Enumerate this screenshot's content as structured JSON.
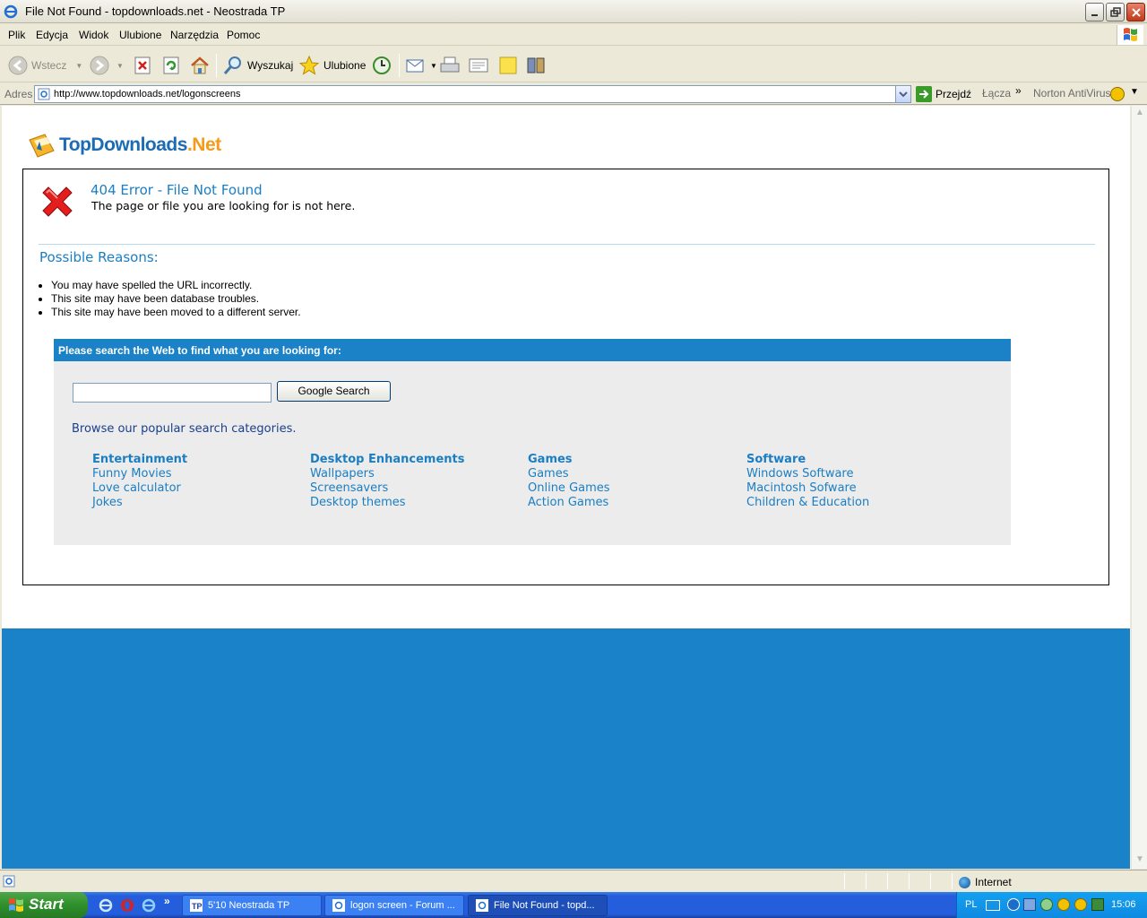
{
  "window": {
    "title": "File Not Found - topdownloads.net - Neostrada TP"
  },
  "menu": [
    "Plik",
    "Edycja",
    "Widok",
    "Ulubione",
    "Narzędzia",
    "Pomoc"
  ],
  "toolbar": {
    "back_label": "Wstecz",
    "search_label": "Wyszukaj",
    "favorites_label": "Ulubione"
  },
  "address": {
    "label": "Adres",
    "url": "http://www.topdownloads.net/logonscreens",
    "go_label": "Przejdź",
    "links_label": "Łącza",
    "links_chevron": "»",
    "norton_label": "Norton AntiVirus"
  },
  "page": {
    "logo_main": "TopDownloads",
    "logo_suffix": ".Net",
    "error_title": "404 Error - File Not Found",
    "error_subtitle": "The page or file you are looking for is not here.",
    "reasons_title": "Possible Reasons:",
    "reasons": [
      "You may have spelled the URL incorrectly.",
      "This site may have been database troubles.",
      "This site may have been moved to a different server."
    ],
    "search_heading": "Please search the Web to find what you are looking for:",
    "search_value": "",
    "search_button": "Google Search",
    "browse_text": "Browse our popular search categories.",
    "categories": [
      {
        "title": "Entertainment",
        "links": [
          "Funny Movies",
          "Love calculator",
          "Jokes"
        ]
      },
      {
        "title": "Desktop Enhancements",
        "links": [
          "Wallpapers",
          "Screensavers",
          "Desktop themes"
        ]
      },
      {
        "title": "Games",
        "links": [
          "Games",
          "Online Games",
          "Action Games"
        ]
      },
      {
        "title": "Software",
        "links": [
          "Windows Software",
          "Macintosh Sofware",
          "Children & Education"
        ]
      }
    ],
    "accent_color": "#1b82c7"
  },
  "status": {
    "zone": "Internet"
  },
  "taskbar": {
    "start_label": "Start",
    "tasks": [
      {
        "label": "5'10 Neostrada TP",
        "active": false
      },
      {
        "label": "logon screen - Forum ...",
        "active": false
      },
      {
        "label": "File Not Found - topd...",
        "active": true
      }
    ],
    "language": "PL",
    "clock": "15:06"
  }
}
